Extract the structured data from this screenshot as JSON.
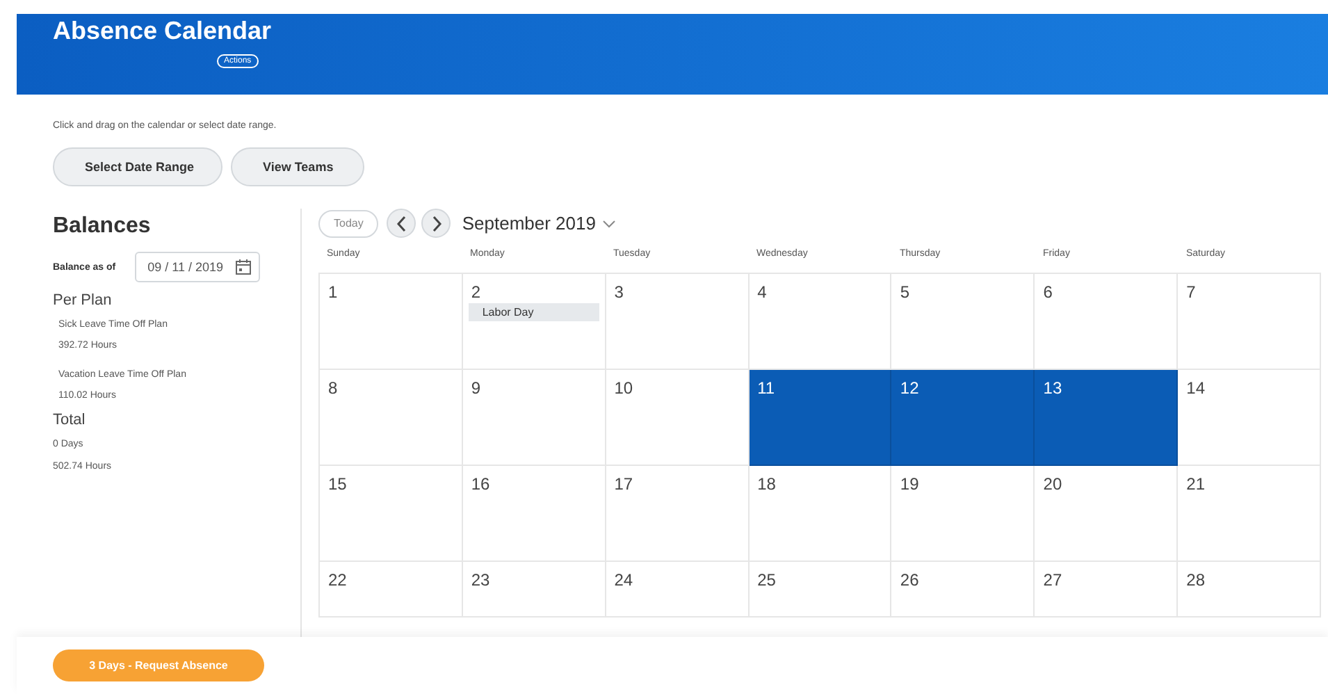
{
  "header": {
    "title": "Absence Calendar",
    "actions_button": "Actions"
  },
  "instruction": "Click and drag on the calendar or select date range.",
  "buttons": [
    "Select Date Range",
    "View Teams"
  ],
  "balances": {
    "title": "Balances",
    "as_of_label": "Balance as of",
    "as_of_date": "09 / 11 / 2019",
    "per_plan_heading": "Per Plan",
    "plans": [
      {
        "name": "Sick Leave Time Off Plan",
        "amount": "392.72 Hours"
      },
      {
        "name": "Vacation Leave Time Off Plan",
        "amount": "110.02 Hours"
      }
    ],
    "total_heading": "Total",
    "totals": [
      "0 Days",
      "502.74 Hours"
    ]
  },
  "calendar": {
    "today_button": "Today",
    "month": "September 2019",
    "weekdays": [
      "Sunday",
      "Monday",
      "Tuesday",
      "Wednesday",
      "Thursday",
      "Friday",
      "Saturday"
    ],
    "weeks": [
      [
        {
          "day": "1",
          "selected": false
        },
        {
          "day": "2",
          "selected": false,
          "events": [
            "Labor Day"
          ]
        },
        {
          "day": "3",
          "selected": false
        },
        {
          "day": "4",
          "selected": false
        },
        {
          "day": "5",
          "selected": false
        },
        {
          "day": "6",
          "selected": false
        },
        {
          "day": "7",
          "selected": false
        }
      ],
      [
        {
          "day": "8",
          "selected": false
        },
        {
          "day": "9",
          "selected": false
        },
        {
          "day": "10",
          "selected": false
        },
        {
          "day": "11",
          "selected": true
        },
        {
          "day": "12",
          "selected": true
        },
        {
          "day": "13",
          "selected": true
        },
        {
          "day": "14",
          "selected": false
        }
      ],
      [
        {
          "day": "15",
          "selected": false
        },
        {
          "day": "16",
          "selected": false
        },
        {
          "day": "17",
          "selected": false
        },
        {
          "day": "18",
          "selected": false
        },
        {
          "day": "19",
          "selected": false
        },
        {
          "day": "20",
          "selected": false
        },
        {
          "day": "21",
          "selected": false
        }
      ],
      [
        {
          "day": "22",
          "selected": false
        },
        {
          "day": "23",
          "selected": false
        },
        {
          "day": "24",
          "selected": false
        },
        {
          "day": "25",
          "selected": false
        },
        {
          "day": "26",
          "selected": false
        },
        {
          "day": "27",
          "selected": false
        },
        {
          "day": "28",
          "selected": false
        }
      ]
    ]
  },
  "footer": {
    "request_button": "3 Days - Request Absence"
  }
}
